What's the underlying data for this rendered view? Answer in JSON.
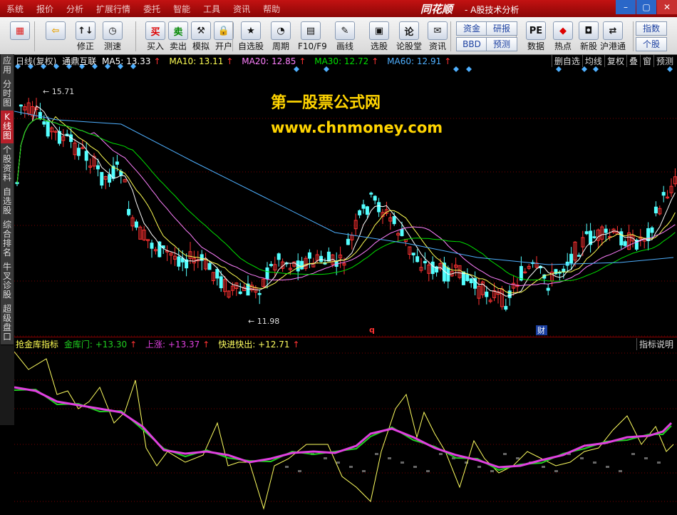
{
  "menubar": {
    "items": [
      "系统",
      "报价",
      "分析",
      "扩展行情",
      "委托",
      "智能",
      "工具",
      "资讯",
      "帮助"
    ],
    "logo": "同花顺",
    "title": "- A股技术分析"
  },
  "toolbar": {
    "buttons": [
      {
        "label": "",
        "icon": "grid-icon"
      },
      {
        "label": "",
        "icon": "back-arrow-icon"
      },
      {
        "label": "修正",
        "icon": "fix-icon"
      },
      {
        "label": "测速",
        "icon": "clock-icon"
      },
      {
        "label": "买入",
        "icon": "buy-icon",
        "glyph": "买"
      },
      {
        "label": "卖出",
        "icon": "sell-icon",
        "glyph": "卖"
      },
      {
        "label": "模拟",
        "icon": "hammer-icon"
      },
      {
        "label": "开户",
        "icon": "lock-icon"
      },
      {
        "label": "自选股",
        "icon": "star-icon"
      },
      {
        "label": "周期",
        "icon": "cycle-icon"
      },
      {
        "label": "F10/F9",
        "icon": "f10-icon"
      },
      {
        "label": "画线",
        "icon": "pen-icon"
      },
      {
        "label": "选股",
        "icon": "select-icon"
      },
      {
        "label": "论股堂",
        "icon": "forum-icon"
      },
      {
        "label": "资讯",
        "icon": "news-icon"
      },
      {
        "label": "数据",
        "icon": "pe-icon",
        "glyph": "PE"
      },
      {
        "label": "热点",
        "icon": "hot-icon"
      },
      {
        "label": "新股",
        "icon": "ipo-icon"
      },
      {
        "label": "沪港通",
        "icon": "hk-icon"
      }
    ],
    "small": {
      "zijin": "资金",
      "bbd": "BBD",
      "yanbao": "研报",
      "yuce": "预测",
      "zhishu": "指数",
      "gegu": "个股"
    }
  },
  "lefttabs": [
    "应用",
    "分时图",
    "K线图",
    "个股资料",
    "自选股",
    "综合排名",
    "牛叉诊股",
    "超级盘口"
  ],
  "price_header": {
    "period": "日线(复权)",
    "name": "通鼎互联",
    "ma5": "MA5: 13.33",
    "ma10": "MA10: 13.11",
    "ma20": "MA20: 12.85",
    "ma30": "MA30: 12.72",
    "ma60": "MA60: 12.91",
    "arrow": "↑",
    "right": [
      "删自选",
      "均线",
      "复权",
      "叠",
      "窗",
      "预测"
    ]
  },
  "annotations": {
    "high": "15.71",
    "low": "11.98",
    "q": "q",
    "cai": "财"
  },
  "watermark": {
    "line1": "第一股票公式网",
    "line2": "www.chnmoney.com"
  },
  "indicator_header": {
    "name": "抢金库指标",
    "jinkumen": "金库门: +13.30",
    "shangzhang": "上涨: +13.37",
    "kuaijin": "快进快出: +12.71",
    "arrow": "↑",
    "help": "指标说明"
  },
  "colors": {
    "up": "#ff3232",
    "down": "#54ffff",
    "ma5": "#ffffff",
    "ma10": "#ffff54",
    "ma20": "#ff80ff",
    "ma30": "#00e000",
    "ma60": "#4fb0ff",
    "purple": "#e040e0",
    "green": "#20d020",
    "yellow": "#ffff60"
  }
}
